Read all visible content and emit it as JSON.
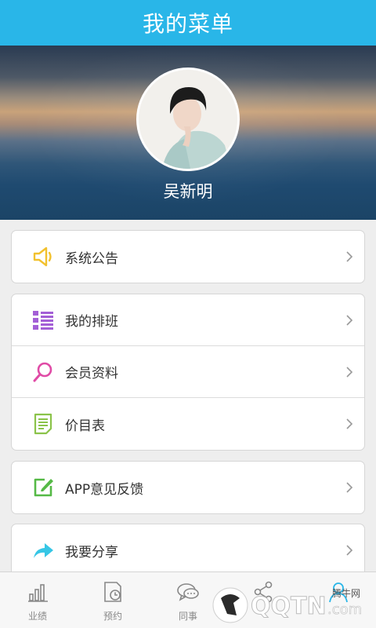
{
  "header": {
    "title": "我的菜单"
  },
  "profile": {
    "name": "吴新明"
  },
  "menu": {
    "group1": [
      {
        "label": "系统公告",
        "icon": "speaker-icon"
      }
    ],
    "group2": [
      {
        "label": "我的排班",
        "icon": "list-icon"
      },
      {
        "label": "会员资料",
        "icon": "search-icon"
      },
      {
        "label": "价目表",
        "icon": "document-icon"
      }
    ],
    "group3": [
      {
        "label": "APP意见反馈",
        "icon": "edit-icon"
      }
    ],
    "group4": [
      {
        "label": "我要分享",
        "icon": "share-arrow-icon"
      }
    ]
  },
  "tabbar": {
    "items": [
      {
        "label": "业绩",
        "icon": "bar-chart-icon"
      },
      {
        "label": "预约",
        "icon": "calendar-clock-icon"
      },
      {
        "label": "同事",
        "icon": "chat-icon"
      },
      {
        "label": "",
        "icon": "share-icon"
      },
      {
        "label": "",
        "icon": "user-icon"
      }
    ]
  },
  "watermark": {
    "text": "QQTN.com",
    "subtext": "腾牛网"
  },
  "colors": {
    "accent": "#29b6e8",
    "speaker": "#f2c12e",
    "list": "#a35fd6",
    "search": "#e04ba6",
    "document": "#8bc34a",
    "edit": "#55b946",
    "share": "#36c6e5"
  }
}
